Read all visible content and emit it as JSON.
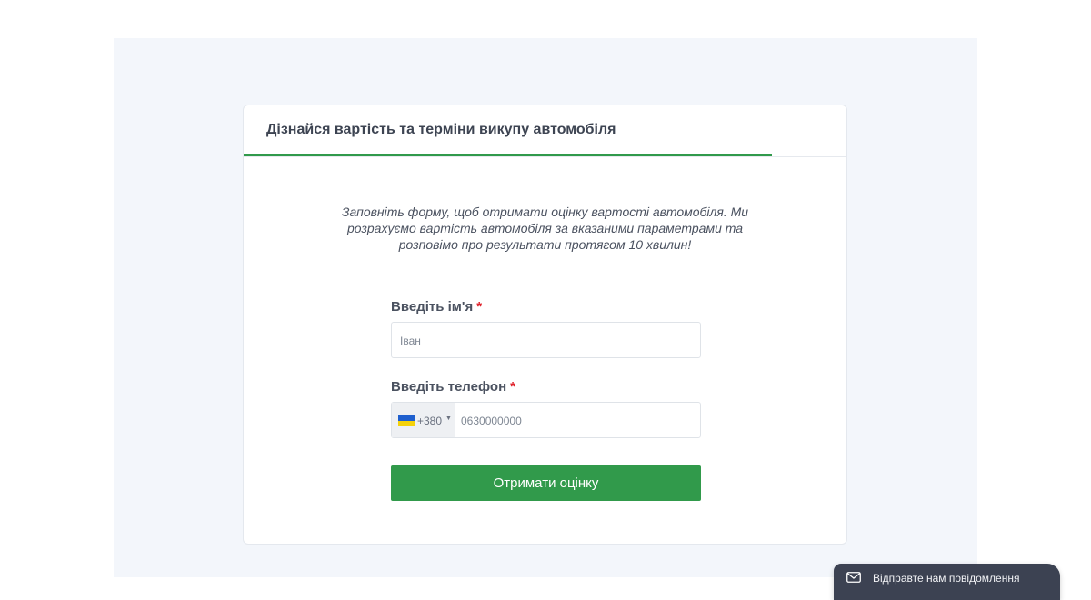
{
  "form": {
    "title": "Дізнайся вартість та терміни викупу автомобіля",
    "progress": 0.876,
    "intro": "Заповніть форму, щоб отримати оцінку вартості автомобіля. Ми розрахуємо вартість автомобіля за вказаними параметрами та розповімо про результати протягом 10 хвилин!",
    "name_label": "Введіть ім'я",
    "name_placeholder": "Іван",
    "phone_label": "Введіть телефон",
    "required_mark": "*",
    "dial_code": "+380",
    "phone_placeholder": "0630000000",
    "submit_label": "Отримати оцінку"
  },
  "chat_widget": {
    "label": "Відправте нам повідомлення",
    "icon": "envelope-icon"
  },
  "colors": {
    "accent": "#319a4b",
    "required": "#e0232c",
    "chat_bg": "#3c4252"
  }
}
